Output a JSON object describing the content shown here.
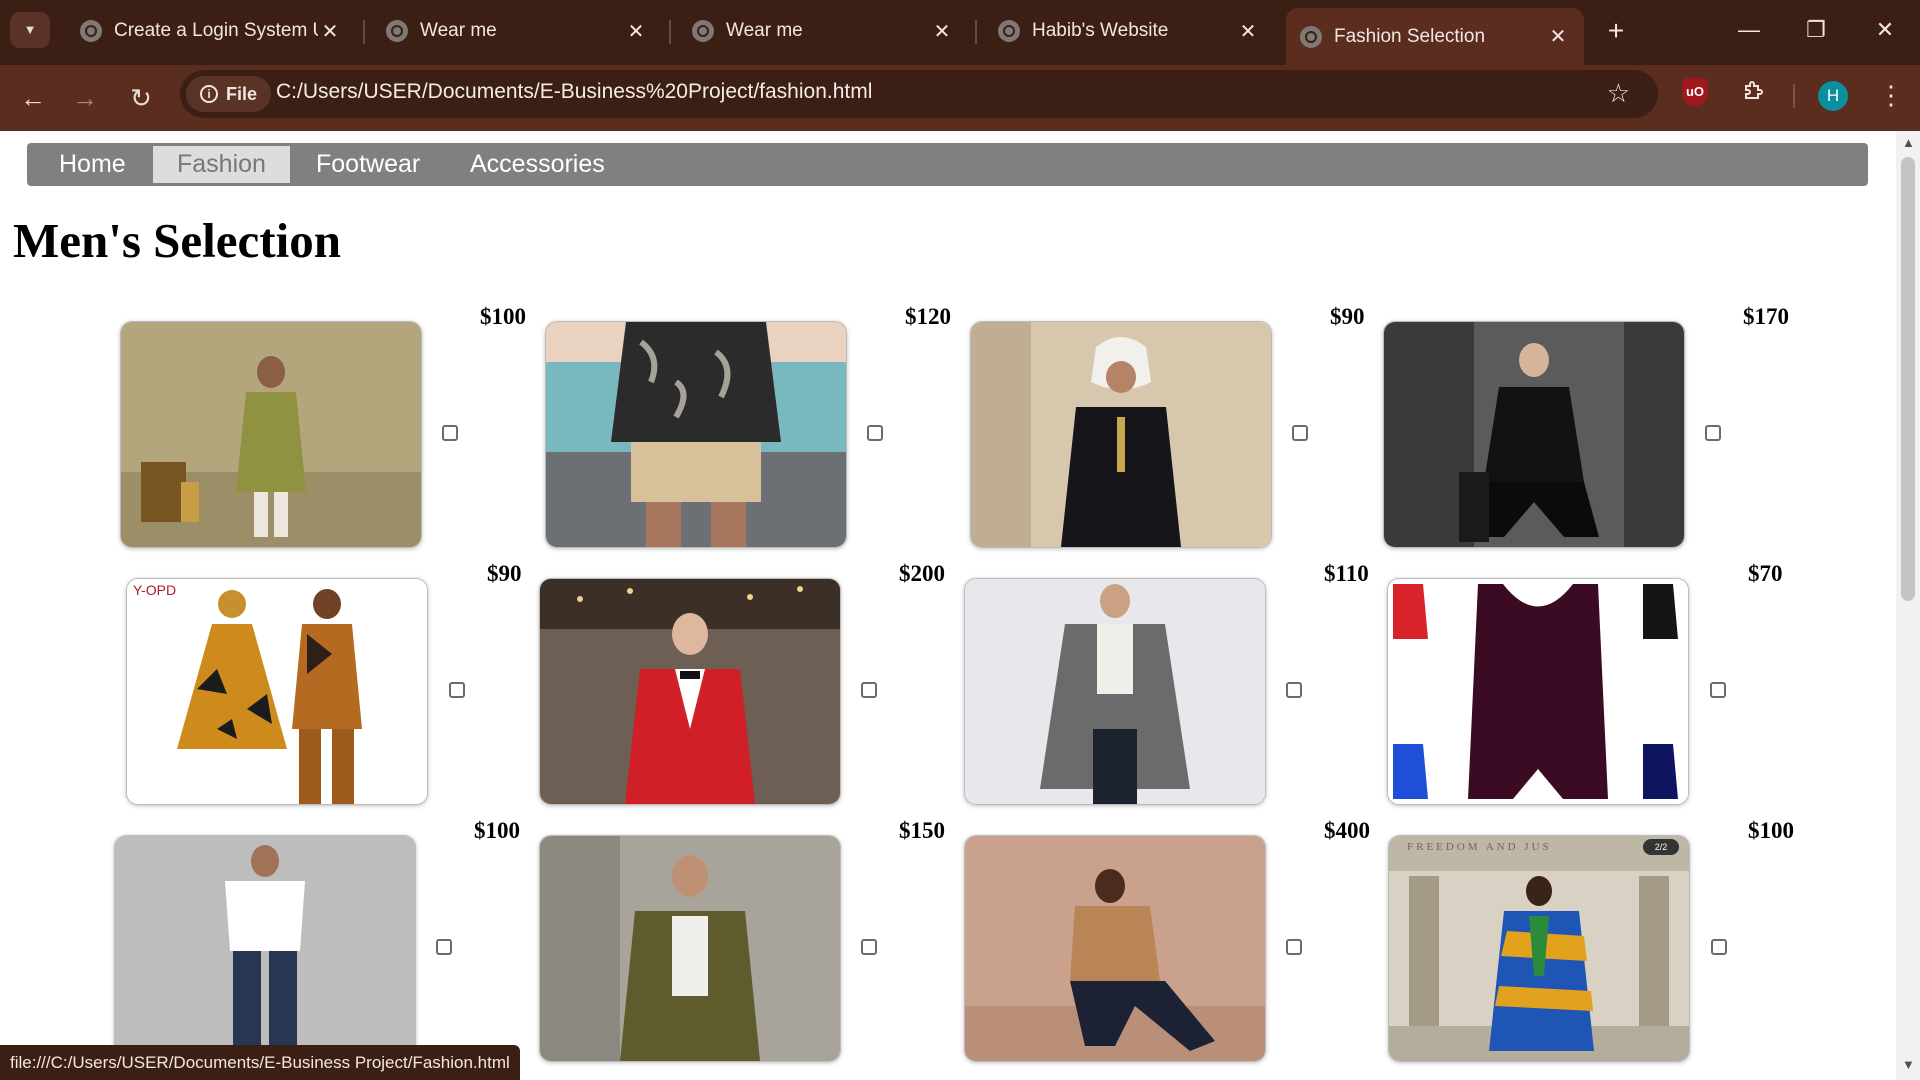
{
  "browser": {
    "tabs": [
      {
        "title": "Create a Login System Us",
        "active": false
      },
      {
        "title": "Wear me",
        "active": false
      },
      {
        "title": "Wear me",
        "active": false
      },
      {
        "title": "Habib's Website",
        "active": false
      },
      {
        "title": "Fashion Selection",
        "active": true
      }
    ],
    "close_glyph": "✕",
    "new_tab_glyph": "+",
    "address": {
      "chip_label": "File",
      "url": "C:/Users/USER/Documents/E-Business%20Project/fashion.html"
    },
    "profile_initial": "H",
    "ublock_label": "uO",
    "status_url": "file:///C:/Users/USER/Documents/E-Business Project/Fashion.html"
  },
  "site": {
    "nav": [
      {
        "label": "Home",
        "active": false
      },
      {
        "label": "Fashion",
        "active": true
      },
      {
        "label": "Footwear",
        "active": false
      },
      {
        "label": "Accessories",
        "active": false
      }
    ],
    "heading": "Men's Selection",
    "products": [
      {
        "price": "$100",
        "depicts": "man in olive green kurta"
      },
      {
        "price": "$120",
        "depicts": "man in black tropical print shirt on pier"
      },
      {
        "price": "$90",
        "depicts": "man in black thobe with white headscarf"
      },
      {
        "price": "$170",
        "depicts": "man in black embellished suit seated"
      },
      {
        "price": "$90",
        "depicts": "couple in African print outfits",
        "image_text": "Y-OPD"
      },
      {
        "price": "$200",
        "depicts": "man in red suit with bow tie"
      },
      {
        "price": "$110",
        "depicts": "man in grey double-breasted coat"
      },
      {
        "price": "$70",
        "depicts": "maroon wrestling singlet with color variants"
      },
      {
        "price": "$100",
        "depicts": "man in white t-shirt and jeans"
      },
      {
        "price": "$150",
        "depicts": "man in olive green jacket"
      },
      {
        "price": "$400",
        "depicts": "man in tan shirt kneeling"
      },
      {
        "price": "$100",
        "depicts": "man in kente cloth at monument",
        "image_text": "FREEDOM AND JUS",
        "image_badge": "2/2"
      }
    ]
  },
  "colors": {
    "titlebar": "#3c1f14",
    "toolbar": "#5a2d1e",
    "site_nav": "#808080",
    "site_nav_active": "#dddddd",
    "avatar": "#0a8fa0"
  }
}
